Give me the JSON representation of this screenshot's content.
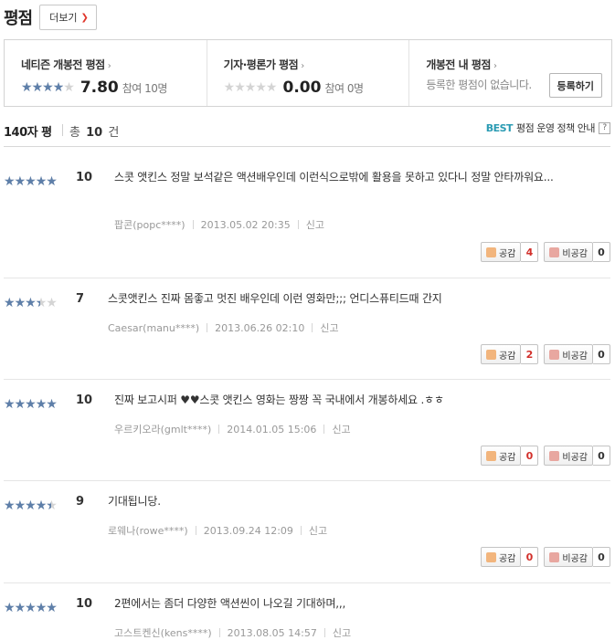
{
  "header": {
    "title": "평점",
    "more_label": "더보기"
  },
  "summary": {
    "netizen": {
      "label": "네티즌 개봉전 평점",
      "score": "7.80",
      "participants": "참여 10명",
      "stars": 4
    },
    "critic": {
      "label": "기자·평론가 평점",
      "score": "0.00",
      "participants": "참여 0명",
      "stars": 0
    },
    "mine": {
      "label": "개봉전 내 평점",
      "text": "등록한 평점이 없습니다.",
      "button": "등록하기"
    }
  },
  "list": {
    "title": "140자 평",
    "total_prefix": "총",
    "total_count": "10",
    "total_suffix": "건",
    "policy_best": "BEST",
    "policy_text": "평점 운영 정책 안내",
    "help": "?"
  },
  "labels": {
    "agree": "공감",
    "disagree": "비공감",
    "report": "신고"
  },
  "colors": {
    "star_fill": "#5e7fa9",
    "star_empty": "#d4d4d4",
    "accent_red": "#d2302b",
    "best_blue": "#2b9bb3"
  },
  "reviews": [
    {
      "stars": 5,
      "score": "10",
      "text": "스콧 앳킨스 정말 보석같은 액션배우인데 이런식으로밖에 활용을 못하고 있다니 정말 안타까워요...",
      "user": "팝콘(popc****)",
      "date": "2013.05.02 20:35",
      "agree": "4",
      "disagree": "0"
    },
    {
      "stars": 3.5,
      "score": "7",
      "text": "스콧앳킨스 진짜 몸좋고 멋진 배우인데 이런 영화만;;; 언디스퓨티드때 간지",
      "user": "Caesar(manu****)",
      "date": "2013.06.26 02:10",
      "agree": "2",
      "disagree": "0"
    },
    {
      "stars": 5,
      "score": "10",
      "text": "진짜 보고시퍼 ♥♥스콧 앳킨스 영화는 짱짱 꼭 국내에서 개봉하세요 .ㅎㅎ",
      "user": "우르키오라(gmlt****)",
      "date": "2014.01.05 15:06",
      "agree": "0",
      "disagree": "0"
    },
    {
      "stars": 4.5,
      "score": "9",
      "text": "기대됩니당.",
      "user": "로웨나(rowe****)",
      "date": "2013.09.24 12:09",
      "agree": "0",
      "disagree": "0"
    },
    {
      "stars": 5,
      "score": "10",
      "text": "2편에서는 좀더 다양한 액션씬이 나오길 기대하며,,,",
      "user": "고스트켄신(kens****)",
      "date": "2013.08.05 14:57",
      "agree": "",
      "disagree": ""
    }
  ]
}
